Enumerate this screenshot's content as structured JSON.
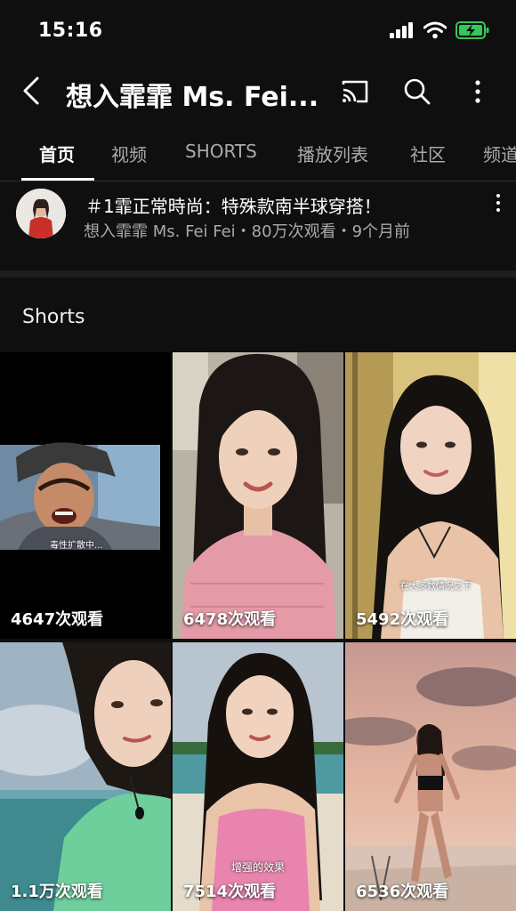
{
  "status": {
    "time": "15:16"
  },
  "header": {
    "title": "想入霏霏 Ms. Fei..."
  },
  "tabs": [
    "首页",
    "视频",
    "SHORTS",
    "播放列表",
    "社区",
    "频道"
  ],
  "featured": {
    "title": "＃1霏正常時尚：特殊款南半球穿搭！",
    "meta": "想入霏霏 Ms. Fei Fei・80万次观看・9个月前"
  },
  "shorts": {
    "heading": "Shorts",
    "items": [
      {
        "views": "4647次观看",
        "caption": "毒性扩散中..."
      },
      {
        "views": "6478次观看",
        "caption": ""
      },
      {
        "views": "5492次观看",
        "caption": "在大多数情况之下"
      },
      {
        "views": "1.1万次观看",
        "caption": ""
      },
      {
        "views": "7514次观看",
        "caption": "增强的效果"
      },
      {
        "views": "6536次观看",
        "caption": ""
      }
    ]
  },
  "colors": {
    "background": "#0f0f0f",
    "text_secondary": "#aaaaaa",
    "battery": "#34c759"
  }
}
